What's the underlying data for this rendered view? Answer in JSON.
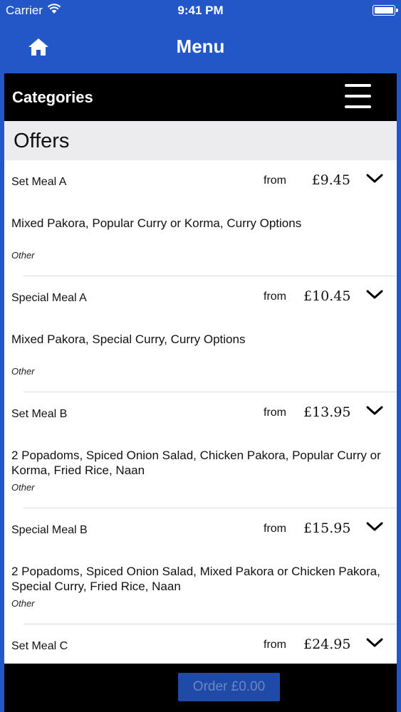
{
  "status_bar": {
    "carrier": "Carrier",
    "time": "9:41 PM"
  },
  "nav": {
    "title": "Menu"
  },
  "categories": {
    "label": "Categories"
  },
  "section": {
    "title": "Offers"
  },
  "items": [
    {
      "name": "Set Meal A",
      "from": "from",
      "price": "£9.45",
      "desc": "Mixed Pakora, Popular Curry or Korma, Curry Options",
      "type": "Other"
    },
    {
      "name": "Special Meal A",
      "from": "from",
      "price": "£10.45",
      "desc": "Mixed Pakora, Special Curry, Curry Options",
      "type": "Other"
    },
    {
      "name": "Set Meal B",
      "from": "from",
      "price": "£13.95",
      "desc": "2 Popadoms, Spiced Onion Salad, Chicken Pakora, Popular Curry or Korma, Fried Rice, Naan",
      "type": "Other"
    },
    {
      "name": "Special Meal B",
      "from": "from",
      "price": "£15.95",
      "desc": "2 Popadoms, Spiced Onion Salad, Mixed Pakora or Chicken Pakora, Special Curry, Fried Rice, Naan",
      "type": "Other"
    },
    {
      "name": "Set Meal C",
      "from": "from",
      "price": "£24.95",
      "desc": "",
      "type": ""
    }
  ],
  "order": {
    "label": "Order £0.00"
  },
  "icons": {
    "home": "home-icon",
    "menu": "hamburger-icon",
    "expand": "chevron-down-icon",
    "wifi": "wifi-icon",
    "battery": "battery-icon"
  },
  "colors": {
    "nav_background": "#2356c7",
    "bar_background": "#000000",
    "order_button": "#1f4aa8"
  }
}
